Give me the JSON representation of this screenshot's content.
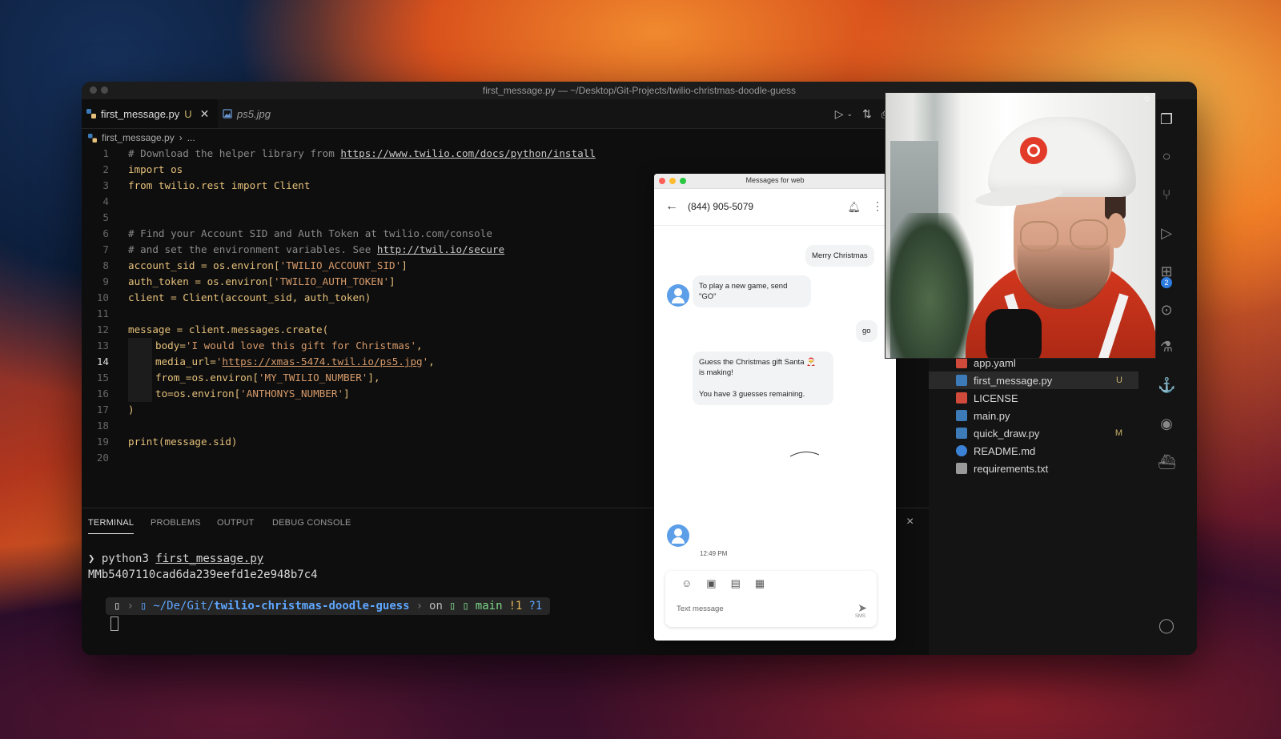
{
  "window": {
    "title": "first_message.py — ~/Desktop/Git-Projects/twilio-christmas-doodle-guess"
  },
  "tabs": [
    {
      "label": "first_message.py",
      "status": "U"
    },
    {
      "label": "ps5.jpg"
    }
  ],
  "breadcrumb": {
    "file": "first_message.py",
    "rest": "..."
  },
  "code": {
    "line_numbers": [
      "1",
      "2",
      "3",
      "4",
      "5",
      "6",
      "7",
      "8",
      "9",
      "10",
      "11",
      "12",
      "13",
      "14",
      "15",
      "16",
      "17",
      "18",
      "19",
      "20"
    ],
    "l1_comment": "# Download the helper library from ",
    "l1_url": "https://www.twilio.com/docs/python/install",
    "l2": "import os",
    "l3": "from twilio.rest import Client",
    "l6": "# Find your Account SID and Auth Token at twilio.com/console",
    "l7_comment": "# and set the environment variables. See ",
    "l7_url": "http://twil.io/secure",
    "l8_a": "account_sid = os.environ[",
    "l8_s": "'TWILIO_ACCOUNT_SID'",
    "l8_b": "]",
    "l9_a": "auth_token = os.environ[",
    "l9_s": "'TWILIO_AUTH_TOKEN'",
    "l9_b": "]",
    "l10": "client = Client(account_sid, auth_token)",
    "l12": "message = client.messages.create(",
    "l13_a": "body=",
    "l13_s": "'I would love this gift for Christmas'",
    "l13_b": ",",
    "l14_a": "media_url=",
    "l14_q1": "'",
    "l14_url": "https://xmas-5474.twil.io/ps5.jpg",
    "l14_q2": "'",
    "l14_b": ",",
    "l15_a": "from_=os.environ[",
    "l15_s": "'MY_TWILIO_NUMBER'",
    "l15_b": "],",
    "l16_a": "to=os.environ[",
    "l16_s": "'ANTHONYS_NUMBER'",
    "l16_b": "]",
    "l17": ")",
    "l19": "print(message.sid)"
  },
  "panel": {
    "tabs": [
      "TERMINAL",
      "PROBLEMS",
      "OUTPUT",
      "DEBUG CONSOLE"
    ],
    "close": "×"
  },
  "terminal": {
    "prompt_symbol": "❯",
    "command": "python3",
    "command_arg": "first_message.py",
    "output": "MMb5407110cad6da239eefd1e2e948b7c4",
    "prompt_path_prefix": "~/De/Git/",
    "prompt_path_dir": "twilio-christmas-doodle-guess",
    "prompt_on": "on",
    "prompt_branch": "main",
    "prompt_status": "!1",
    "prompt_status2": "?1"
  },
  "explorer": {
    "files": [
      {
        "name": "app.yaml",
        "color": "#d04a3c",
        "badge": ""
      },
      {
        "name": "first_message.py",
        "color": "#3d7ab8",
        "badge": "U"
      },
      {
        "name": "LICENSE",
        "color": "#d04a3c",
        "badge": ""
      },
      {
        "name": "main.py",
        "color": "#3d7ab8",
        "badge": ""
      },
      {
        "name": "quick_draw.py",
        "color": "#3d7ab8",
        "badge": "M"
      },
      {
        "name": "README.md",
        "color": "#3b82d6",
        "badge": ""
      },
      {
        "name": "requirements.txt",
        "color": "#9a9a9a",
        "badge": ""
      }
    ],
    "scm_badge": "2"
  },
  "messages": {
    "title": "Messages for web",
    "number": "(844) 905-5079",
    "bubble_out_1": "Merry Christmas",
    "bubble_in_1": "To play a new game, send \"GO\"",
    "bubble_out_2": "go",
    "bubble_in_2_line1": "Guess the Christmas gift Santa 🎅",
    "bubble_in_2_line2": "is making!",
    "bubble_in_2_line3": "You have 3 guesses remaining.",
    "time": "12:49 PM",
    "compose_placeholder": "Text message",
    "send_label": "SMS"
  },
  "colors": {
    "editor_bg": "#0e0e0e",
    "accent_blue": "#5ea7ff",
    "string_orange": "#d69a6a"
  }
}
